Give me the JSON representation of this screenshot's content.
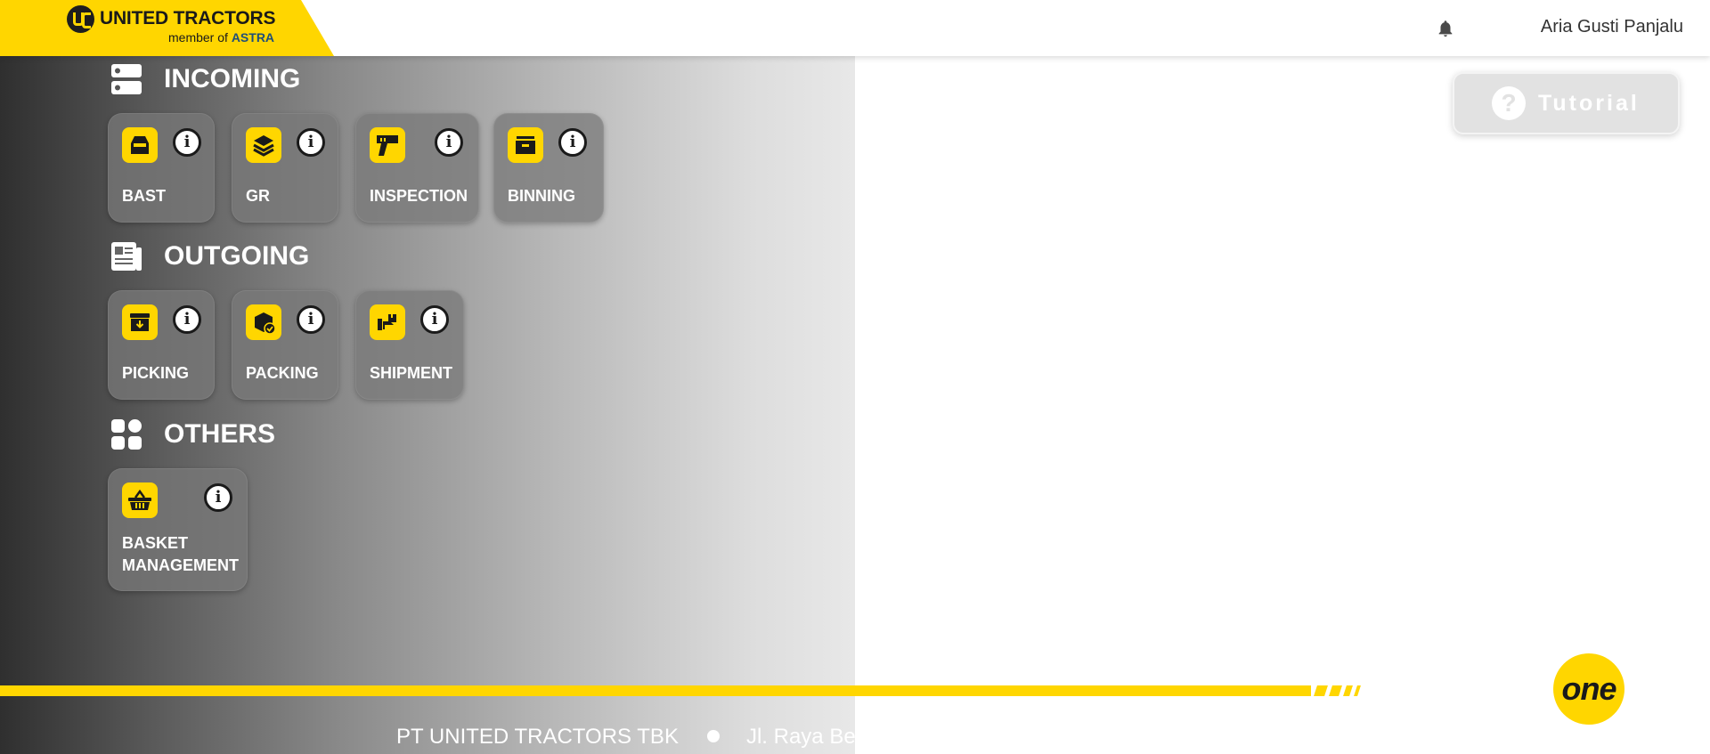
{
  "header": {
    "logo_name": "UNITED TRACTORS",
    "logo_sub_prefix": "member of",
    "logo_sub_brand": "ASTRA",
    "user_name": "Aria Gusti Panjalu",
    "notification_icon": "bell-icon"
  },
  "tutorial": {
    "label": "Tutorial",
    "icon": "?"
  },
  "sections": {
    "incoming": {
      "title": "INCOMING",
      "icon": "server-list-icon",
      "items": [
        {
          "label": "BAST",
          "icon": "inbox-icon"
        },
        {
          "label": "GR",
          "icon": "layers-icon"
        },
        {
          "label": "INSPECTION",
          "icon": "scanner-gun-icon"
        },
        {
          "label": "BINNING",
          "icon": "bin-box-icon"
        }
      ]
    },
    "outgoing": {
      "title": "OUTGOING",
      "icon": "newspaper-icon",
      "items": [
        {
          "label": "PICKING",
          "icon": "archive-download-icon"
        },
        {
          "label": "PACKING",
          "icon": "package-check-icon"
        },
        {
          "label": "SHIPMENT",
          "icon": "hand-box-icon"
        }
      ]
    },
    "others": {
      "title": "OTHERS",
      "icon": "grid-icon",
      "items": [
        {
          "label_line1": "BASKET",
          "label_line2": "MANAGEMENT",
          "icon": "basket-icon"
        }
      ]
    }
  },
  "info_glyph": "i",
  "footer": {
    "company": "PT UNITED TRACTORS TBK",
    "address": "Jl. Raya Be",
    "badge": "one"
  },
  "colors": {
    "brand_yellow": "#ffd600",
    "dark": "#1a1a1a",
    "white": "#ffffff"
  }
}
